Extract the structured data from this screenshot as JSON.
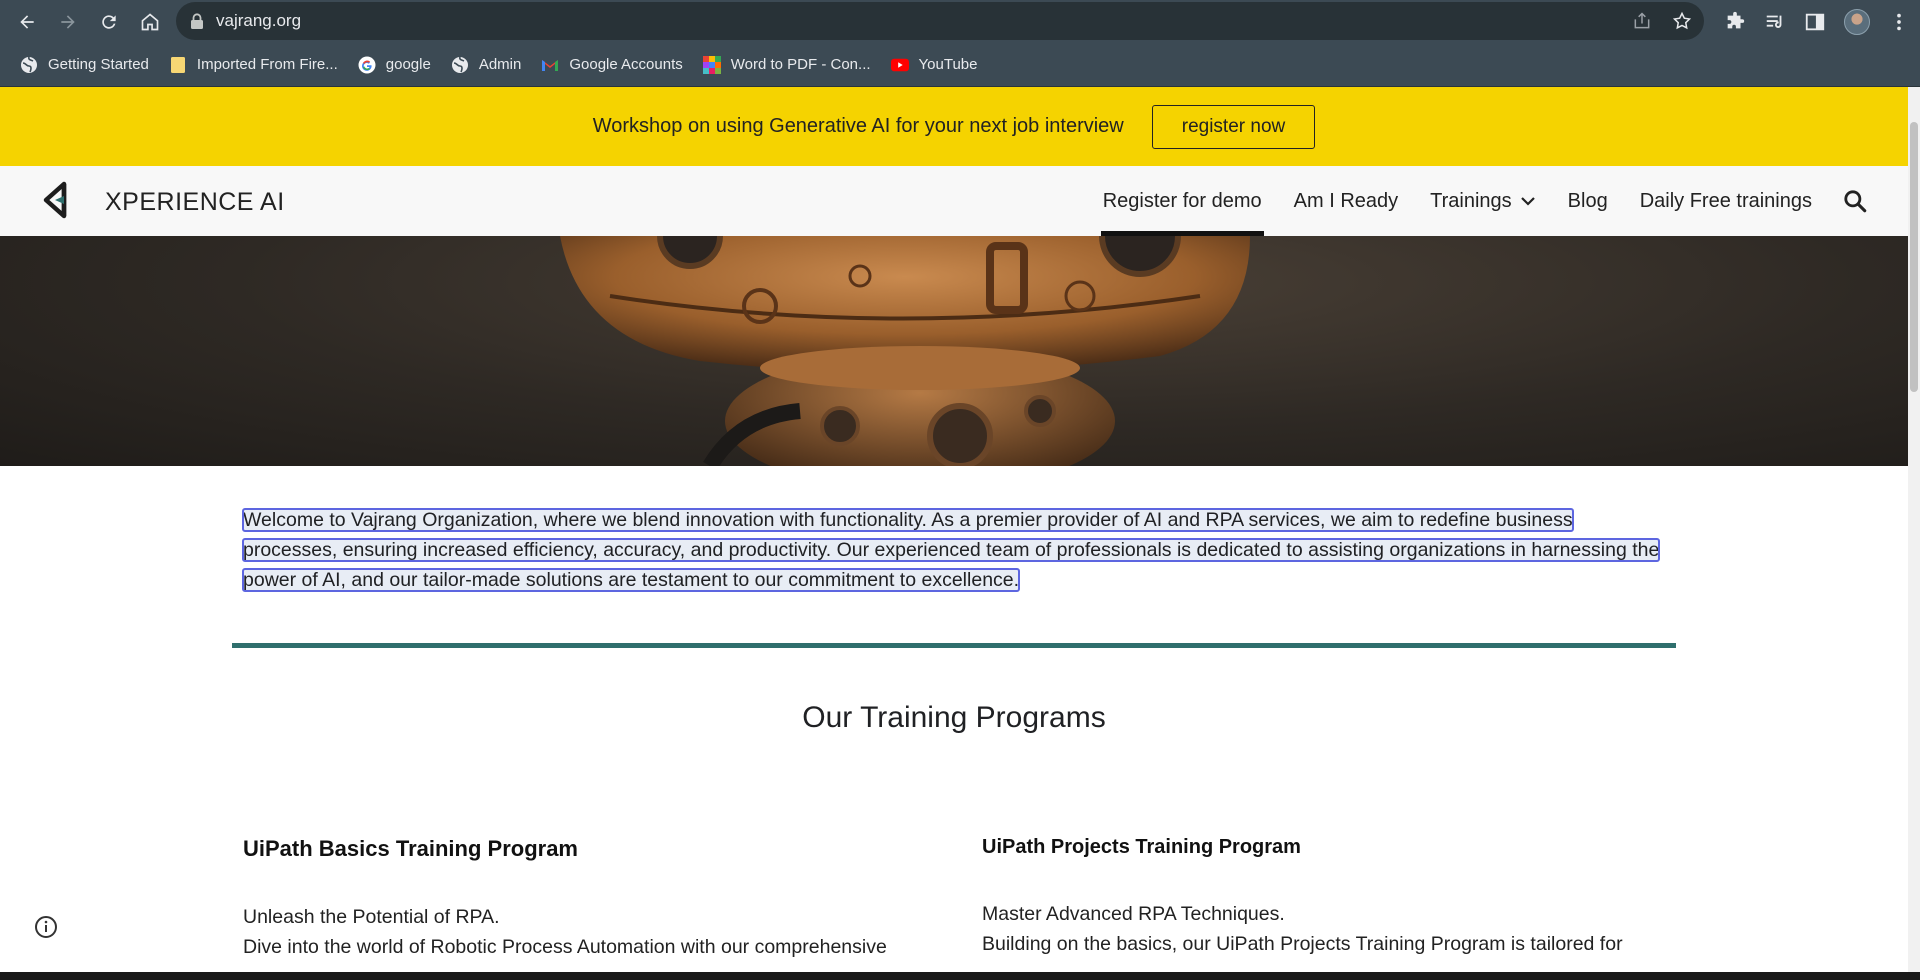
{
  "browser": {
    "url": "vajrang.org",
    "bookmarks": [
      {
        "label": "Getting Started",
        "icon": "globe-icon"
      },
      {
        "label": "Imported From Fire...",
        "icon": "folder-icon"
      },
      {
        "label": "google",
        "icon": "google-icon"
      },
      {
        "label": "Admin",
        "icon": "globe-icon"
      },
      {
        "label": "Google Accounts",
        "icon": "gmail-icon"
      },
      {
        "label": "Word to PDF - Con...",
        "icon": "grid-logo-icon"
      },
      {
        "label": "YouTube",
        "icon": "youtube-icon"
      }
    ]
  },
  "announcement": {
    "text": "Workshop on using Generative AI for your next job interview",
    "button": "register now",
    "background": "#f5d300"
  },
  "site": {
    "title": "XPERIENCE AI",
    "nav": [
      {
        "label": "Register for demo",
        "active": true
      },
      {
        "label": "Am I Ready"
      },
      {
        "label": "Trainings",
        "has_dropdown": true
      },
      {
        "label": "Blog"
      },
      {
        "label": "Daily Free trainings"
      }
    ]
  },
  "intro": {
    "text": "Welcome to Vajrang Organization, where we blend innovation with functionality. As a premier provider of AI and RPA services, we aim to redefine business processes, ensuring increased efficiency, accuracy, and productivity. Our experienced team of professionals is dedicated to assisting organizations in harnessing the power of AI, and our tailor-made solutions are testament to our commitment to excellence."
  },
  "section": {
    "title": "Our Training Programs",
    "divider_color": "#2f6f6d"
  },
  "programs": [
    {
      "title": "UiPath Basics Training Program",
      "tagline": "Unleash the Potential of RPA.",
      "description": "Dive into the world of Robotic Process Automation with our comprehensive"
    },
    {
      "title": "UiPath Projects Training Program",
      "tagline": "Master Advanced RPA Techniques.",
      "description": "Building on the basics, our UiPath Projects Training Program is tailored for"
    }
  ]
}
